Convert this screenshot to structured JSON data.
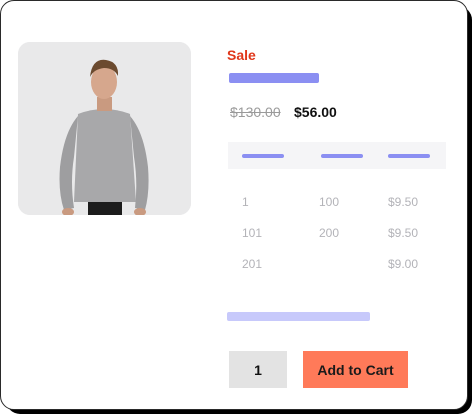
{
  "product": {
    "sale_label": "Sale",
    "old_price": "$130.00",
    "new_price": "$56.00",
    "image_alt": "man in grey sweatshirt"
  },
  "pricing_tiers": {
    "rows": [
      {
        "min": "1",
        "max": "100",
        "price": "$9.50"
      },
      {
        "min": "101",
        "max": "200",
        "price": "$9.50"
      },
      {
        "min": "201",
        "max": "",
        "price": "$9.00"
      }
    ]
  },
  "cart": {
    "quantity": "1",
    "add_label": "Add to Cart"
  },
  "colors": {
    "sale": "#e0371a",
    "accent": "#8b8ff2",
    "button": "#ff7a59"
  }
}
